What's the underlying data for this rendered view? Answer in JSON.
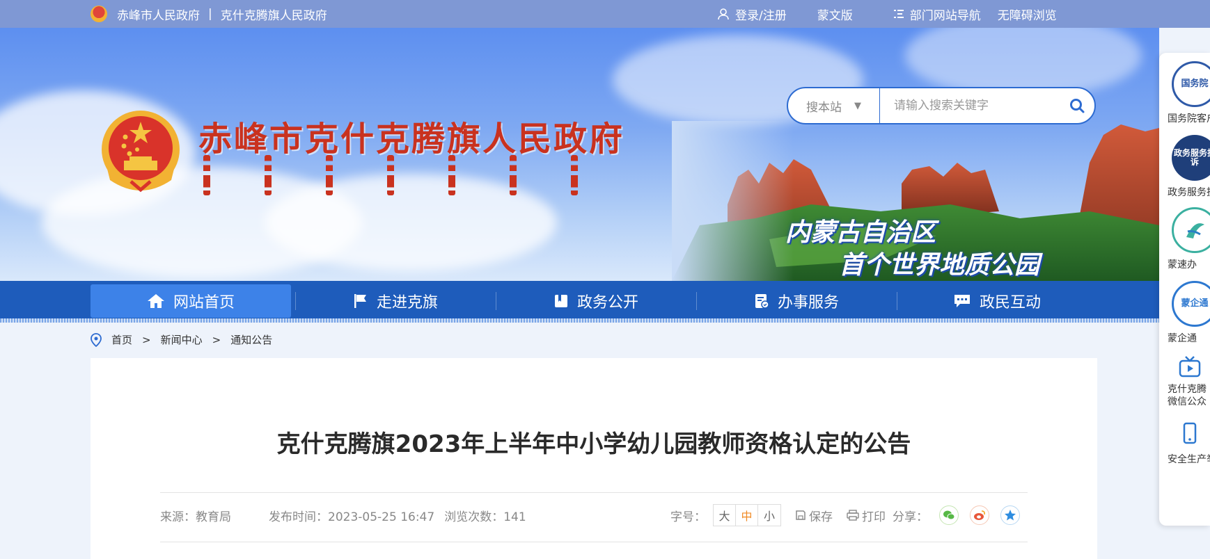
{
  "topbar": {
    "city_gov": "赤峰市人民政府",
    "separator": "|",
    "county_gov": "克什克腾旗人民政府",
    "login": "登录/注册",
    "mongolian": "蒙文版",
    "dept_nav": "部门网站导航",
    "accessibility": "无障碍浏览"
  },
  "banner": {
    "title": "赤峰市克什克腾旗人民政府",
    "slogan_line1": "内蒙古自治区",
    "slogan_line2": "首个世界地质公园"
  },
  "search": {
    "scope": "搜本站",
    "placeholder": "请输入搜索关键字"
  },
  "nav": {
    "items": [
      {
        "label": "网站首页",
        "icon": "home-icon"
      },
      {
        "label": "走进克旗",
        "icon": "flag-icon"
      },
      {
        "label": "政务公开",
        "icon": "book-icon"
      },
      {
        "label": "办事服务",
        "icon": "service-icon"
      },
      {
        "label": "政民互动",
        "icon": "chat-icon"
      }
    ]
  },
  "breadcrumb": {
    "home": "首页",
    "sep": ">",
    "level2": "新闻中心",
    "level3": "通知公告"
  },
  "article": {
    "title": "克什克腾旗2023年上半年中小学幼儿园教师资格认定的公告",
    "source_label": "来源：",
    "source": "教育局",
    "publish_label": "发布时间：",
    "publish_time": "2023-05-25 16:47",
    "views_label": "浏览次数：",
    "views": "141",
    "font_size_label": "字号：",
    "font_large": "大",
    "font_medium": "中",
    "font_small": "小",
    "save": "保存",
    "print": "打印",
    "share_label": "分享："
  },
  "side_panel": {
    "items": [
      {
        "icon_text": "国务院",
        "label": "国务院客户"
      },
      {
        "icon_text": "政务服务投诉",
        "label": "政务服务投"
      },
      {
        "icon_text": "",
        "label": "蒙速办"
      },
      {
        "icon_text": "蒙企通",
        "label": "蒙企通"
      },
      {
        "icon_text": "",
        "label_line1": "克什克腾",
        "label_line2": "微信公众"
      },
      {
        "icon_text": "",
        "label": "安全生产举"
      }
    ]
  },
  "colors": {
    "topbar": "#7f98d4",
    "nav": "#1e5cbb",
    "nav_active": "#3d82e8",
    "title_red": "#c9321f",
    "accent_orange": "#f08a24"
  }
}
